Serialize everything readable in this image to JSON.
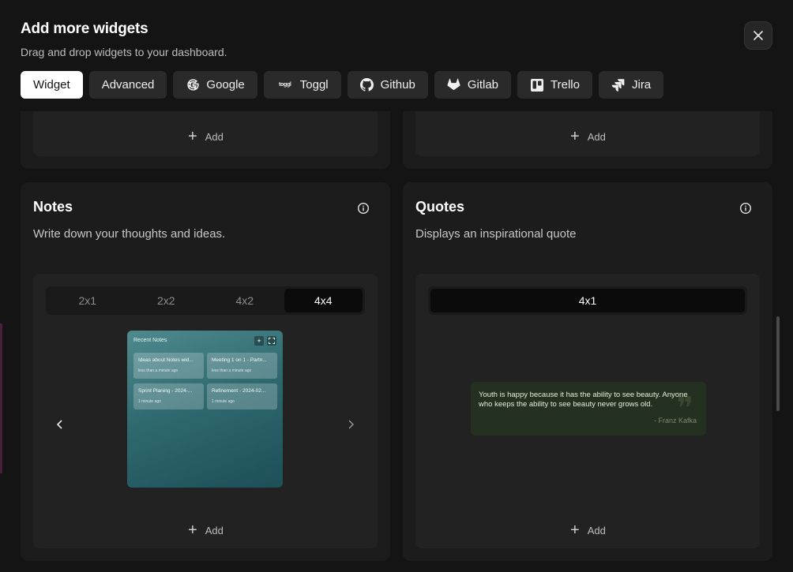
{
  "header": {
    "title": "Add more widgets",
    "subtitle": "Drag and drop widgets to your dashboard."
  },
  "tabs": [
    {
      "label": "Widget",
      "icon": ""
    },
    {
      "label": "Advanced",
      "icon": ""
    },
    {
      "label": "Google",
      "icon": "google-icon"
    },
    {
      "label": "Toggl",
      "icon": "toggl-icon"
    },
    {
      "label": "Github",
      "icon": "github-icon"
    },
    {
      "label": "Gitlab",
      "icon": "gitlab-icon"
    },
    {
      "label": "Trello",
      "icon": "trello-icon"
    },
    {
      "label": "Jira",
      "icon": "jira-icon"
    }
  ],
  "toggl_icon_text": "toggl",
  "add_label": "Add",
  "notes": {
    "title": "Notes",
    "description": "Write down your thoughts and ideas.",
    "sizes": [
      "2x1",
      "2x2",
      "4x2",
      "4x4"
    ],
    "selected_size": "4x4",
    "preview": {
      "title": "Recent Notes",
      "notes": [
        {
          "title": "Ideas about Notes wid...",
          "meta": "less than a minute ago"
        },
        {
          "title": "Meeting 1 on 1 - Partn...",
          "meta": "less than a minute ago"
        },
        {
          "title": "Sprint Planing - 2024-...",
          "meta": "1 minute ago"
        },
        {
          "title": "Refinement - 2024-02...",
          "meta": "1 minute ago"
        }
      ]
    }
  },
  "quotes": {
    "title": "Quotes",
    "description": "Displays an inspirational quote",
    "sizes": [
      "4x1"
    ],
    "selected_size": "4x1",
    "preview": {
      "quote": "Youth is happy because it has the ability to see beauty. Anyone who keeps the ability to see beauty never grows old.",
      "author": "- Franz Kafka"
    }
  },
  "colors": {
    "background": "#141414",
    "card": "#1c1c1c",
    "active_tab": "#ffffff"
  }
}
